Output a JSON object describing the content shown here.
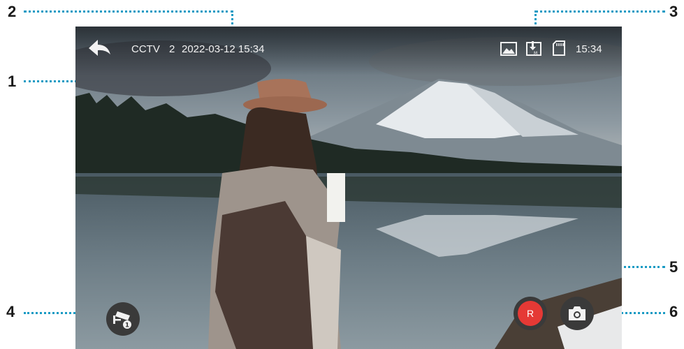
{
  "callouts": [
    "1",
    "2",
    "3",
    "4",
    "5",
    "6"
  ],
  "status_bar": {
    "channel": "CCTV",
    "channel_number": "2",
    "datetime": "2022-03-12 15:34",
    "clock": "15:34"
  },
  "controls": {
    "record_label": "R",
    "record_color": "#e53935"
  },
  "icons": {
    "back": "back-arrow-icon",
    "image": "image-icon",
    "memory_download": "memory-download-icon",
    "sd_card": "sd-card-icon",
    "cctv": "cctv-camera-icon",
    "camera": "camera-icon"
  },
  "colors": {
    "callout_line": "#1a9bc4",
    "button_bg": "#3a3a3a"
  }
}
